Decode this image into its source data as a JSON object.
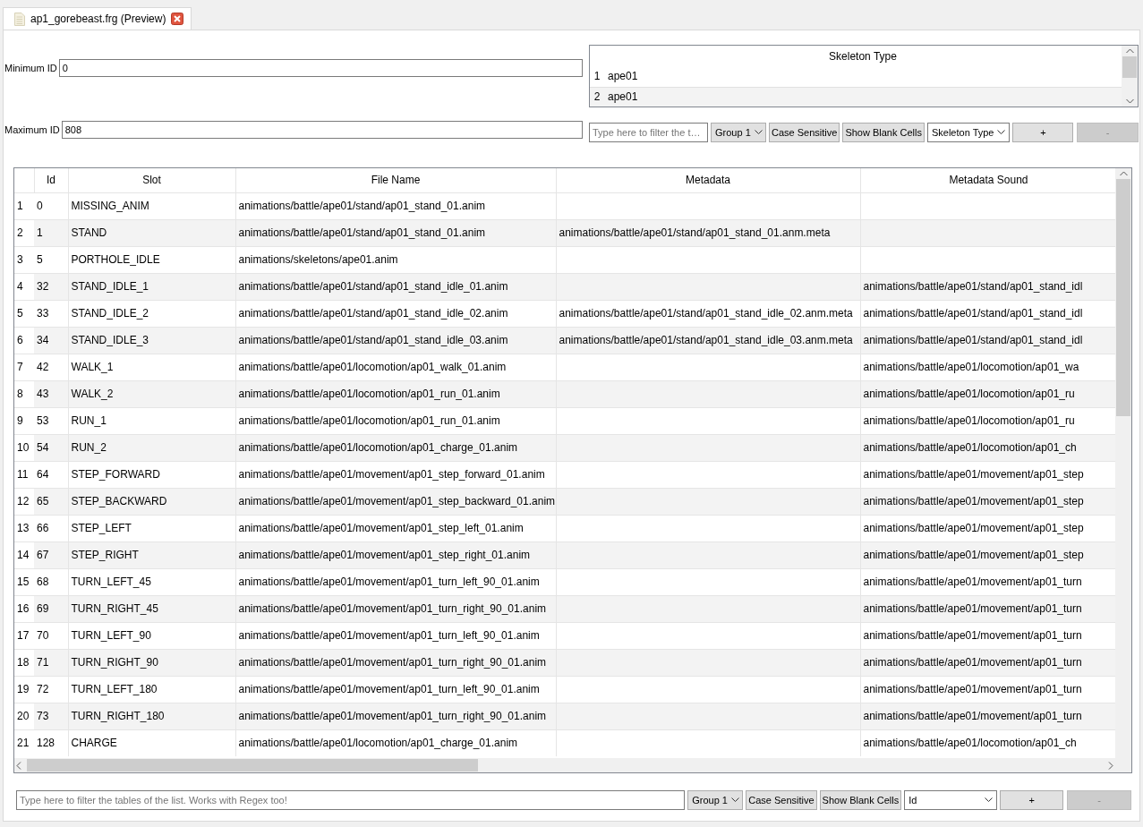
{
  "tab": {
    "title": "ap1_gorebeast.frg (Preview)",
    "selected": true
  },
  "min_id": {
    "label": "Minimum ID",
    "value": "0"
  },
  "max_id": {
    "label": "Maximum ID",
    "value": "808"
  },
  "skeleton_table": {
    "columns": [
      "Skeleton Type"
    ],
    "rows": [
      {
        "index": "1",
        "cells": [
          "ape01"
        ]
      },
      {
        "index": "2",
        "cells": [
          "ape01"
        ]
      }
    ]
  },
  "skeleton_filter": {
    "placeholder": "Type here to filter the t…",
    "group": "Group 1",
    "case_button": "Case Sensitive",
    "blank_button": "Show Blank Cells",
    "column": "Skeleton Type",
    "add_button": {
      "label": "+",
      "disabled": false
    },
    "remove_button": {
      "label": "-",
      "disabled": true
    }
  },
  "table": {
    "columns": [
      "Id",
      "Slot",
      "File Name",
      "Metadata",
      "Metadata Sound"
    ],
    "rows": [
      {
        "index": "1",
        "id": "0",
        "slot": "MISSING_ANIM",
        "file_name": "animations/battle/ape01/stand/ap01_stand_01.anim"
      },
      {
        "index": "2",
        "id": "1",
        "slot": "STAND",
        "file_name": "animations/battle/ape01/stand/ap01_stand_01.anim",
        "metadata": "animations/battle/ape01/stand/ap01_stand_01.anm.meta"
      },
      {
        "index": "3",
        "id": "5",
        "slot": "PORTHOLE_IDLE",
        "file_name": "animations/skeletons/ape01.anim"
      },
      {
        "index": "4",
        "id": "32",
        "slot": "STAND_IDLE_1",
        "file_name": "animations/battle/ape01/stand/ap01_stand_idle_01.anim",
        "metadata_sound": "animations/battle/ape01/stand/ap01_stand_idl"
      },
      {
        "index": "5",
        "id": "33",
        "slot": "STAND_IDLE_2",
        "file_name": "animations/battle/ape01/stand/ap01_stand_idle_02.anim",
        "metadata": "animations/battle/ape01/stand/ap01_stand_idle_02.anm.meta",
        "metadata_sound": "animations/battle/ape01/stand/ap01_stand_idl"
      },
      {
        "index": "6",
        "id": "34",
        "slot": "STAND_IDLE_3",
        "file_name": "animations/battle/ape01/stand/ap01_stand_idle_03.anim",
        "metadata": "animations/battle/ape01/stand/ap01_stand_idle_03.anm.meta",
        "metadata_sound": "animations/battle/ape01/stand/ap01_stand_idl"
      },
      {
        "index": "7",
        "id": "42",
        "slot": "WALK_1",
        "file_name": "animations/battle/ape01/locomotion/ap01_walk_01.anim",
        "metadata_sound": "animations/battle/ape01/locomotion/ap01_wa"
      },
      {
        "index": "8",
        "id": "43",
        "slot": "WALK_2",
        "file_name": "animations/battle/ape01/locomotion/ap01_run_01.anim",
        "metadata_sound": "animations/battle/ape01/locomotion/ap01_ru"
      },
      {
        "index": "9",
        "id": "53",
        "slot": "RUN_1",
        "file_name": "animations/battle/ape01/locomotion/ap01_run_01.anim",
        "metadata_sound": "animations/battle/ape01/locomotion/ap01_ru"
      },
      {
        "index": "10",
        "id": "54",
        "slot": "RUN_2",
        "file_name": "animations/battle/ape01/locomotion/ap01_charge_01.anim",
        "metadata_sound": "animations/battle/ape01/locomotion/ap01_ch"
      },
      {
        "index": "11",
        "id": "64",
        "slot": "STEP_FORWARD",
        "file_name": "animations/battle/ape01/movement/ap01_step_forward_01.anim",
        "metadata_sound": "animations/battle/ape01/movement/ap01_step"
      },
      {
        "index": "12",
        "id": "65",
        "slot": "STEP_BACKWARD",
        "file_name": "animations/battle/ape01/movement/ap01_step_backward_01.anim",
        "metadata_sound": "animations/battle/ape01/movement/ap01_step"
      },
      {
        "index": "13",
        "id": "66",
        "slot": "STEP_LEFT",
        "file_name": "animations/battle/ape01/movement/ap01_step_left_01.anim",
        "metadata_sound": "animations/battle/ape01/movement/ap01_step"
      },
      {
        "index": "14",
        "id": "67",
        "slot": "STEP_RIGHT",
        "file_name": "animations/battle/ape01/movement/ap01_step_right_01.anim",
        "metadata_sound": "animations/battle/ape01/movement/ap01_step"
      },
      {
        "index": "15",
        "id": "68",
        "slot": "TURN_LEFT_45",
        "file_name": "animations/battle/ape01/movement/ap01_turn_left_90_01.anim",
        "metadata_sound": "animations/battle/ape01/movement/ap01_turn"
      },
      {
        "index": "16",
        "id": "69",
        "slot": "TURN_RIGHT_45",
        "file_name": "animations/battle/ape01/movement/ap01_turn_right_90_01.anim",
        "metadata_sound": "animations/battle/ape01/movement/ap01_turn"
      },
      {
        "index": "17",
        "id": "70",
        "slot": "TURN_LEFT_90",
        "file_name": "animations/battle/ape01/movement/ap01_turn_left_90_01.anim",
        "metadata_sound": "animations/battle/ape01/movement/ap01_turn"
      },
      {
        "index": "18",
        "id": "71",
        "slot": "TURN_RIGHT_90",
        "file_name": "animations/battle/ape01/movement/ap01_turn_right_90_01.anim",
        "metadata_sound": "animations/battle/ape01/movement/ap01_turn"
      },
      {
        "index": "19",
        "id": "72",
        "slot": "TURN_LEFT_180",
        "file_name": "animations/battle/ape01/movement/ap01_turn_left_90_01.anim",
        "metadata_sound": "animations/battle/ape01/movement/ap01_turn"
      },
      {
        "index": "20",
        "id": "73",
        "slot": "TURN_RIGHT_180",
        "file_name": "animations/battle/ape01/movement/ap01_turn_right_90_01.anim",
        "metadata_sound": "animations/battle/ape01/movement/ap01_turn"
      },
      {
        "index": "21",
        "id": "128",
        "slot": "CHARGE",
        "file_name": "animations/battle/ape01/locomotion/ap01_charge_01.anim",
        "metadata_sound": "animations/battle/ape01/locomotion/ap01_ch"
      }
    ]
  },
  "table_filter": {
    "placeholder": "Type here to filter the tables of the list. Works with Regex too!",
    "group": "Group 1",
    "case_button": "Case Sensitive",
    "blank_button": "Show Blank Cells",
    "column": "Id",
    "add_button": {
      "label": "+",
      "disabled": false
    },
    "remove_button": {
      "label": "-",
      "disabled": true
    }
  }
}
